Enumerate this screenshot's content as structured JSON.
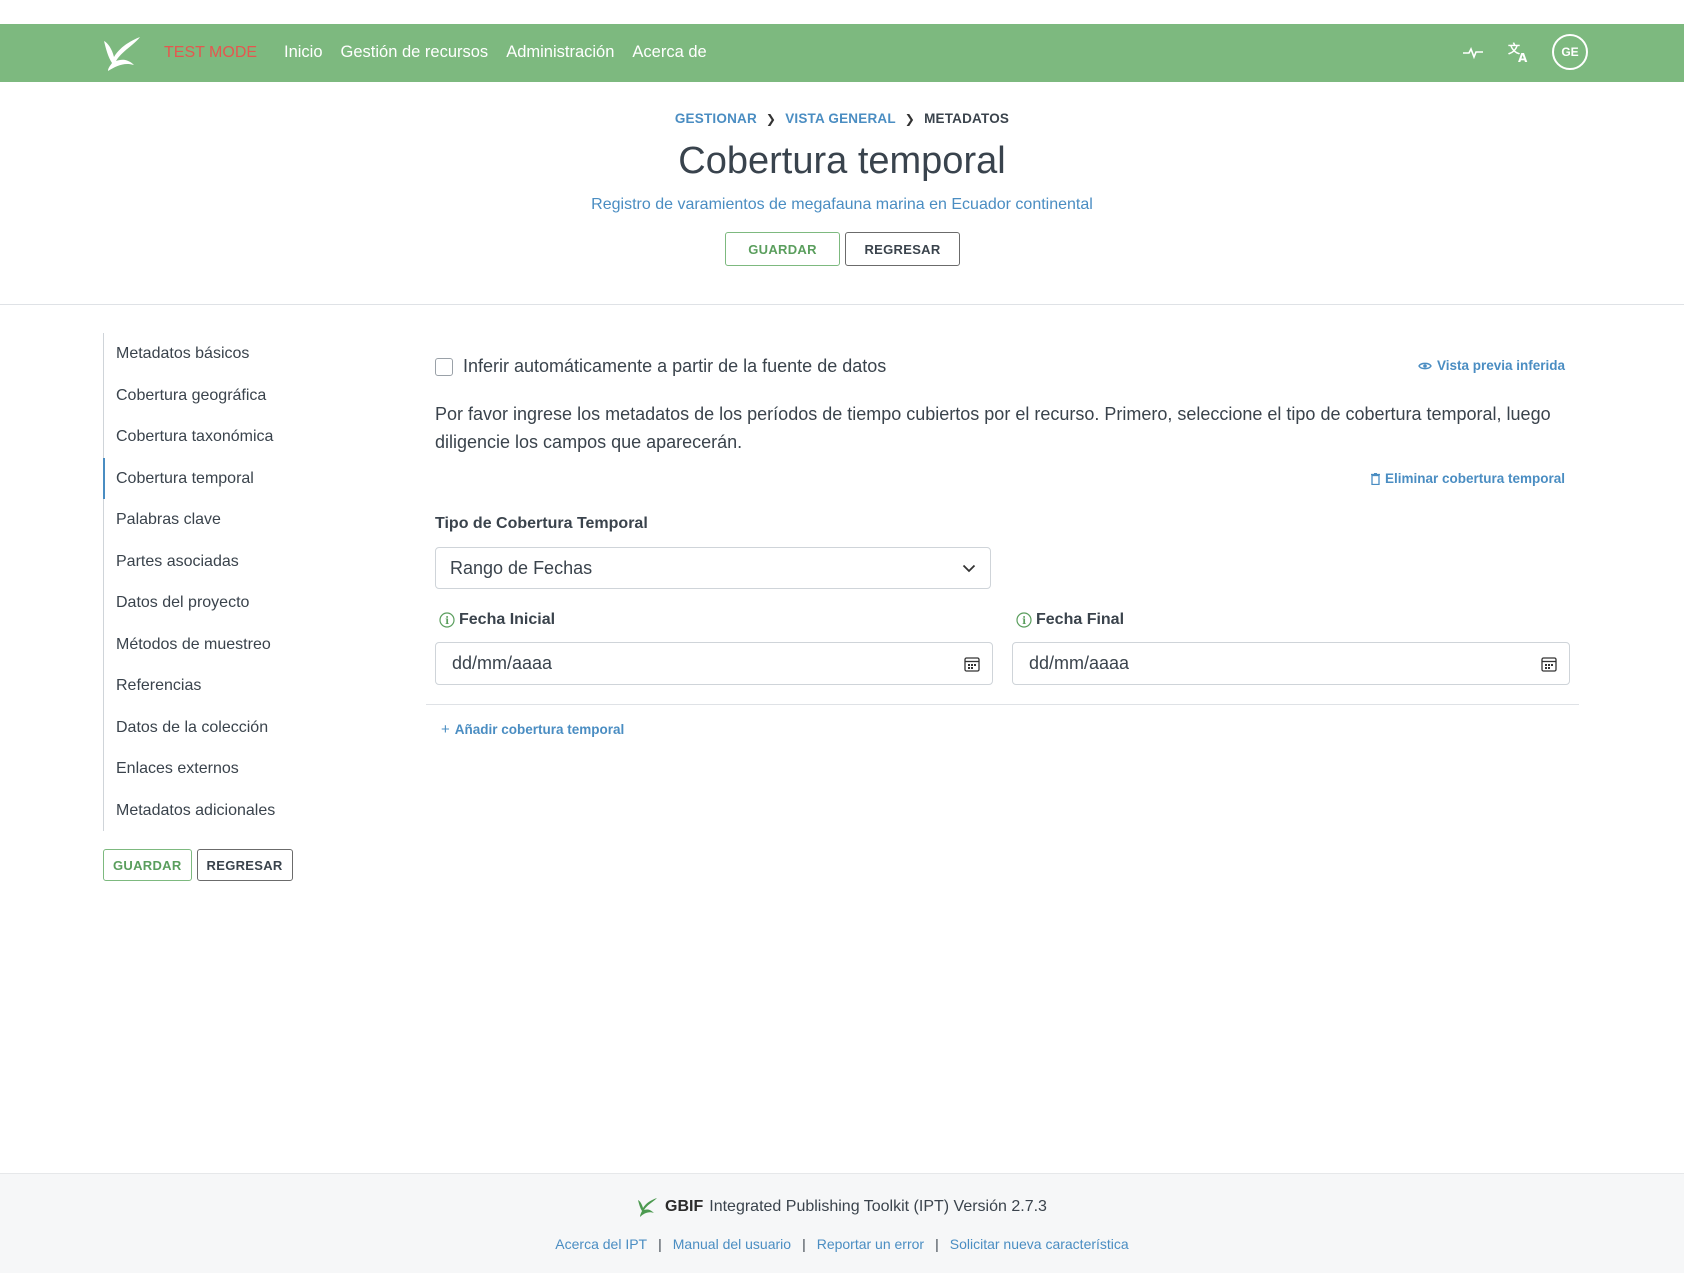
{
  "nav": {
    "test_mode": "TEST MODE",
    "links": [
      "Inicio",
      "Gestión de recursos",
      "Administración",
      "Acerca de"
    ],
    "avatar": "GE",
    "icons": [
      "leaf-logo-icon",
      "activity-icon",
      "language-icon"
    ],
    "bg_color": "#7db97f"
  },
  "breadcrumb": {
    "items": [
      "GESTIONAR",
      "VISTA GENERAL"
    ],
    "current": "METADATOS"
  },
  "page": {
    "title": "Cobertura temporal",
    "subtitle": "Registro de varamientos de megafauna marina en Ecuador continental",
    "save_label": "GUARDAR",
    "back_label": "REGRESAR"
  },
  "sidebar": {
    "items": [
      "Metadatos básicos",
      "Cobertura geográfica",
      "Cobertura taxonómica",
      "Cobertura temporal",
      "Palabras clave",
      "Partes asociadas",
      "Datos del proyecto",
      "Métodos de muestreo",
      "Referencias",
      "Datos de la colección",
      "Enlaces externos",
      "Metadatos adicionales"
    ],
    "active": "Cobertura temporal",
    "save_label": "GUARDAR",
    "back_label": "REGRESAR"
  },
  "main": {
    "infer_label": "Inferir automáticamente a partir de la fuente de datos",
    "preview_link": "Vista previa inferida",
    "intro": "Por favor ingrese los metadatos de los períodos de tiempo cubiertos por el recurso. Primero, seleccione el tipo de cobertura temporal, luego diligencie los campos que aparecerán.",
    "delete_link": "Eliminar cobertura temporal",
    "type_label": "Tipo de Cobertura Temporal",
    "type_value": "Rango de Fechas",
    "start_label": "Fecha Inicial",
    "start_placeholder": "dd/mm/aaaa",
    "end_label": "Fecha Final",
    "end_placeholder": "dd/mm/aaaa",
    "add_link": "Añadir cobertura temporal"
  },
  "footer": {
    "brand": "GBIF",
    "product": "Integrated Publishing Toolkit (IPT) Versión 2.7.3",
    "links": [
      "Acerca del IPT",
      "Manual del usuario",
      "Reportar un error",
      "Solicitar nueva característica"
    ]
  },
  "colors": {
    "accent": "#4a8dc2",
    "green": "#7db97f",
    "test_mode": "#e5574f"
  }
}
